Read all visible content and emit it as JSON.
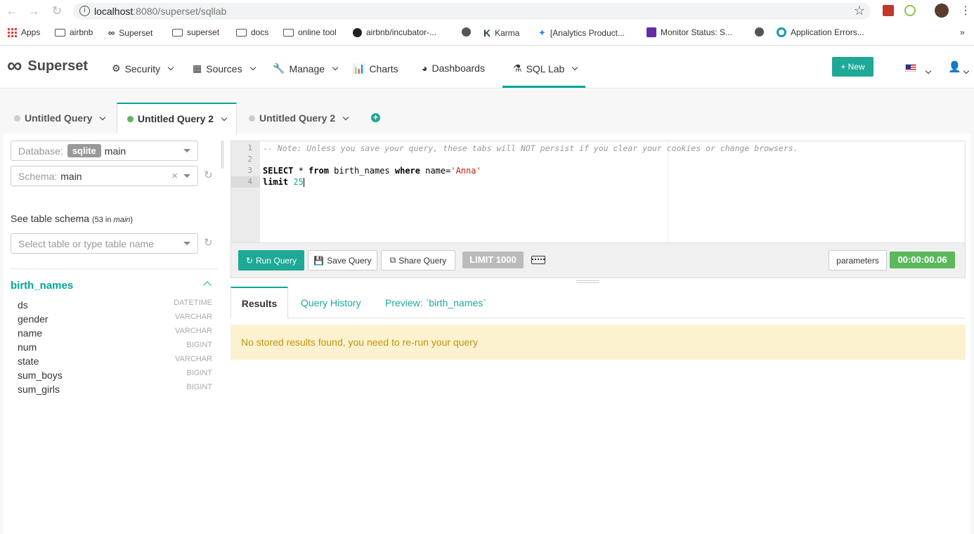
{
  "browser": {
    "url_host": "localhost",
    "url_rest": ":8080/superset/sqllab",
    "bookmarks": [
      "Apps",
      "airbnb",
      "Superset",
      "superset",
      "docs",
      "online tool",
      "airbnb/incubator-...",
      "Karma",
      "[Analytics Product...",
      "Monitor Status: S...",
      "Application Errors..."
    ],
    "more": "»"
  },
  "navbar": {
    "brand": "Superset",
    "items": [
      "Security",
      "Sources",
      "Manage",
      "Charts",
      "Dashboards",
      "SQL Lab"
    ],
    "new_label": "New"
  },
  "query_tabs": [
    "Untitled Query",
    "Untitled Query 2",
    "Untitled Query 2"
  ],
  "left": {
    "database_label": "Database:",
    "database_badge": "sqlite",
    "database_value": "main",
    "schema_label": "Schema:",
    "schema_value": "main",
    "clear": "×",
    "schema_heading": "See table schema",
    "schema_count_prefix": "(53 in ",
    "schema_count_name": "main",
    "schema_count_suffix": ")",
    "table_placeholder": "Select table or type table name",
    "table_name": "birth_names",
    "columns": [
      {
        "name": "ds",
        "type": "DATETIME"
      },
      {
        "name": "gender",
        "type": "VARCHAR"
      },
      {
        "name": "name",
        "type": "VARCHAR"
      },
      {
        "name": "num",
        "type": "BIGINT"
      },
      {
        "name": "state",
        "type": "VARCHAR"
      },
      {
        "name": "sum_boys",
        "type": "BIGINT"
      },
      {
        "name": "sum_girls",
        "type": "BIGINT"
      }
    ]
  },
  "editor": {
    "line_numbers": [
      "1",
      "2",
      "3",
      "4"
    ],
    "line1": "-- Note: Unless you save your query, these tabs will NOT persist if you clear your cookies or change browsers.",
    "l3_select": "SELECT",
    "l3_star": " * ",
    "l3_from": "from",
    "l3_table": " birth_names ",
    "l3_where": "where",
    "l3_cond": " name=",
    "l3_str": "'Anna'",
    "l4_limit": "limit ",
    "l4_num": "25"
  },
  "toolbar": {
    "run": "Run Query",
    "save": "Save Query",
    "share": "Share Query",
    "limit": "LIMIT 1000",
    "parameters": "parameters",
    "timer": "00:00:00.06"
  },
  "results": {
    "tabs": [
      "Results",
      "Query History",
      "Preview: `birth_names`"
    ],
    "alert": "No stored results found, you need to re-run your query"
  },
  "colors": {
    "accent": "#00A699",
    "button": "#1ea896",
    "timer": "#5cb85c",
    "alert_bg": "#fcf2cf"
  }
}
